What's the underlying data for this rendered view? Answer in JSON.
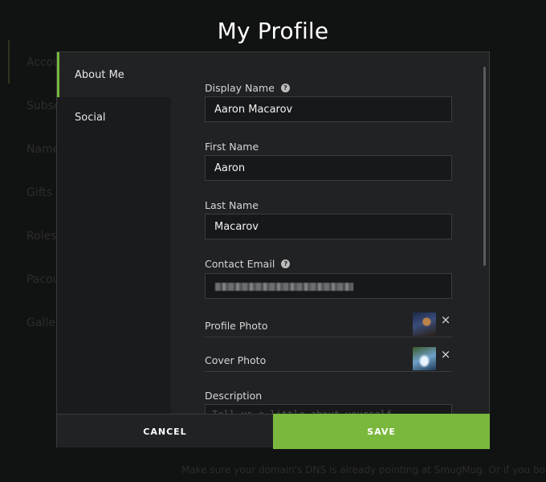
{
  "page": {
    "title": "My Profile"
  },
  "background": {
    "nav": [
      "Accou",
      "Subsc",
      "Name",
      "Gifts",
      "Roles",
      "Pacou",
      "Galle"
    ],
    "footer_text": "Make sure your domain's DNS is already pointing at SmugMug. Or if you bough"
  },
  "modal": {
    "tabs": [
      {
        "label": "About Me",
        "active": true
      },
      {
        "label": "Social",
        "active": false
      }
    ],
    "fields": {
      "display_name": {
        "label": "Display Name",
        "value": "Aaron Macarov",
        "help": "?"
      },
      "first_name": {
        "label": "First Name",
        "value": "Aaron"
      },
      "last_name": {
        "label": "Last Name",
        "value": "Macarov"
      },
      "contact_email": {
        "label": "Contact Email",
        "help": "?"
      },
      "profile_photo": {
        "label": "Profile Photo",
        "remove": "×"
      },
      "cover_photo": {
        "label": "Cover Photo",
        "remove": "×"
      },
      "description": {
        "label": "Description",
        "placeholder": "Tell us a little about yourself"
      }
    },
    "buttons": {
      "cancel": "CANCEL",
      "save": "SAVE"
    }
  },
  "colors": {
    "accent": "#7ab83d",
    "background": "#111212",
    "modal": "#212224"
  }
}
